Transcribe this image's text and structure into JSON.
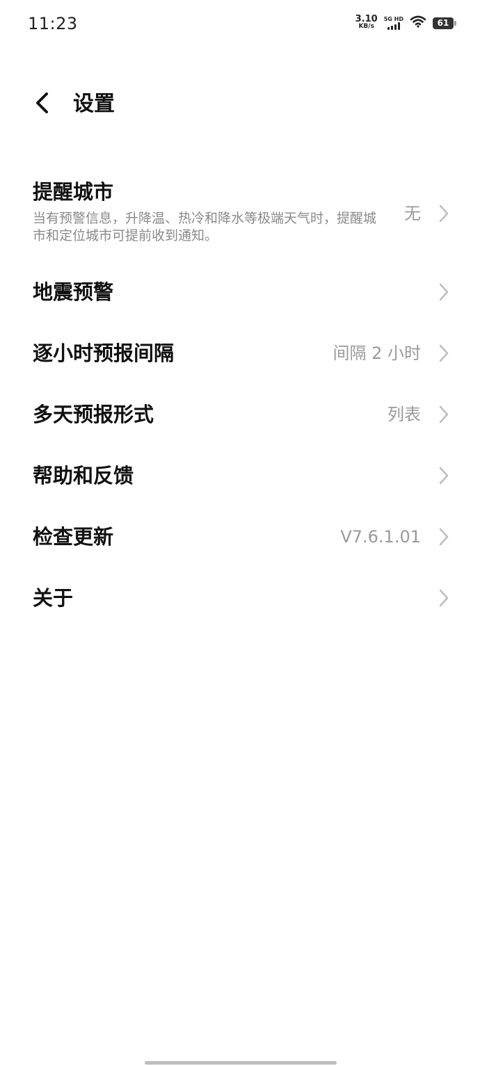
{
  "status_bar": {
    "time": "11:23",
    "net_speed": "3.10",
    "net_unit": "KB/s",
    "network_tag": "5G HD",
    "signal_icon": "signal-bars-icon",
    "wifi_icon": "wifi-icon",
    "battery": "61"
  },
  "header": {
    "back_icon": "chevron-left-icon",
    "title": "设置"
  },
  "settings": [
    {
      "title": "提醒城市",
      "description": "当有预警信息，升降温、热冷和降水等极端天气时，提醒城市和定位城市可提前收到通知。",
      "value": "无"
    },
    {
      "title": "地震预警",
      "value": ""
    },
    {
      "title": "逐小时预报间隔",
      "value": "间隔 2 小时"
    },
    {
      "title": "多天预报形式",
      "value": "列表"
    },
    {
      "title": "帮助和反馈",
      "value": ""
    },
    {
      "title": "检查更新",
      "value": "V7.6.1.01"
    },
    {
      "title": "关于",
      "value": ""
    }
  ],
  "colors": {
    "background": "#ffffff",
    "title_text": "#111111",
    "secondary_text": "#9a9a9a",
    "chevron": "#bdbdbd"
  }
}
